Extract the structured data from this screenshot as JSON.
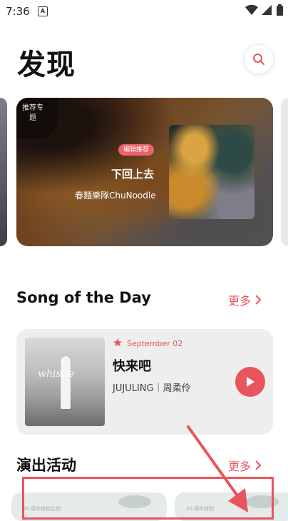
{
  "status_bar": {
    "time": "7:36",
    "app_icon": "A"
  },
  "header": {
    "title": "发现"
  },
  "banner": {
    "badge": "推荐专题",
    "tag": "编辑推荐",
    "song": "下回上去",
    "artist": "春麵樂隊ChuNoodle"
  },
  "song_of_day": {
    "title": "Song of the Day",
    "more": "更多",
    "date": "September 02",
    "song": "快来吧",
    "artist": "JUJULING｜周柔伶",
    "cover_text": "whistle"
  },
  "events": {
    "title": "演出活动",
    "more": "更多",
    "card1_text": "20 周年特别企划",
    "card2_text": "20 周年特别"
  },
  "colors": {
    "accent": "#e8555c"
  }
}
